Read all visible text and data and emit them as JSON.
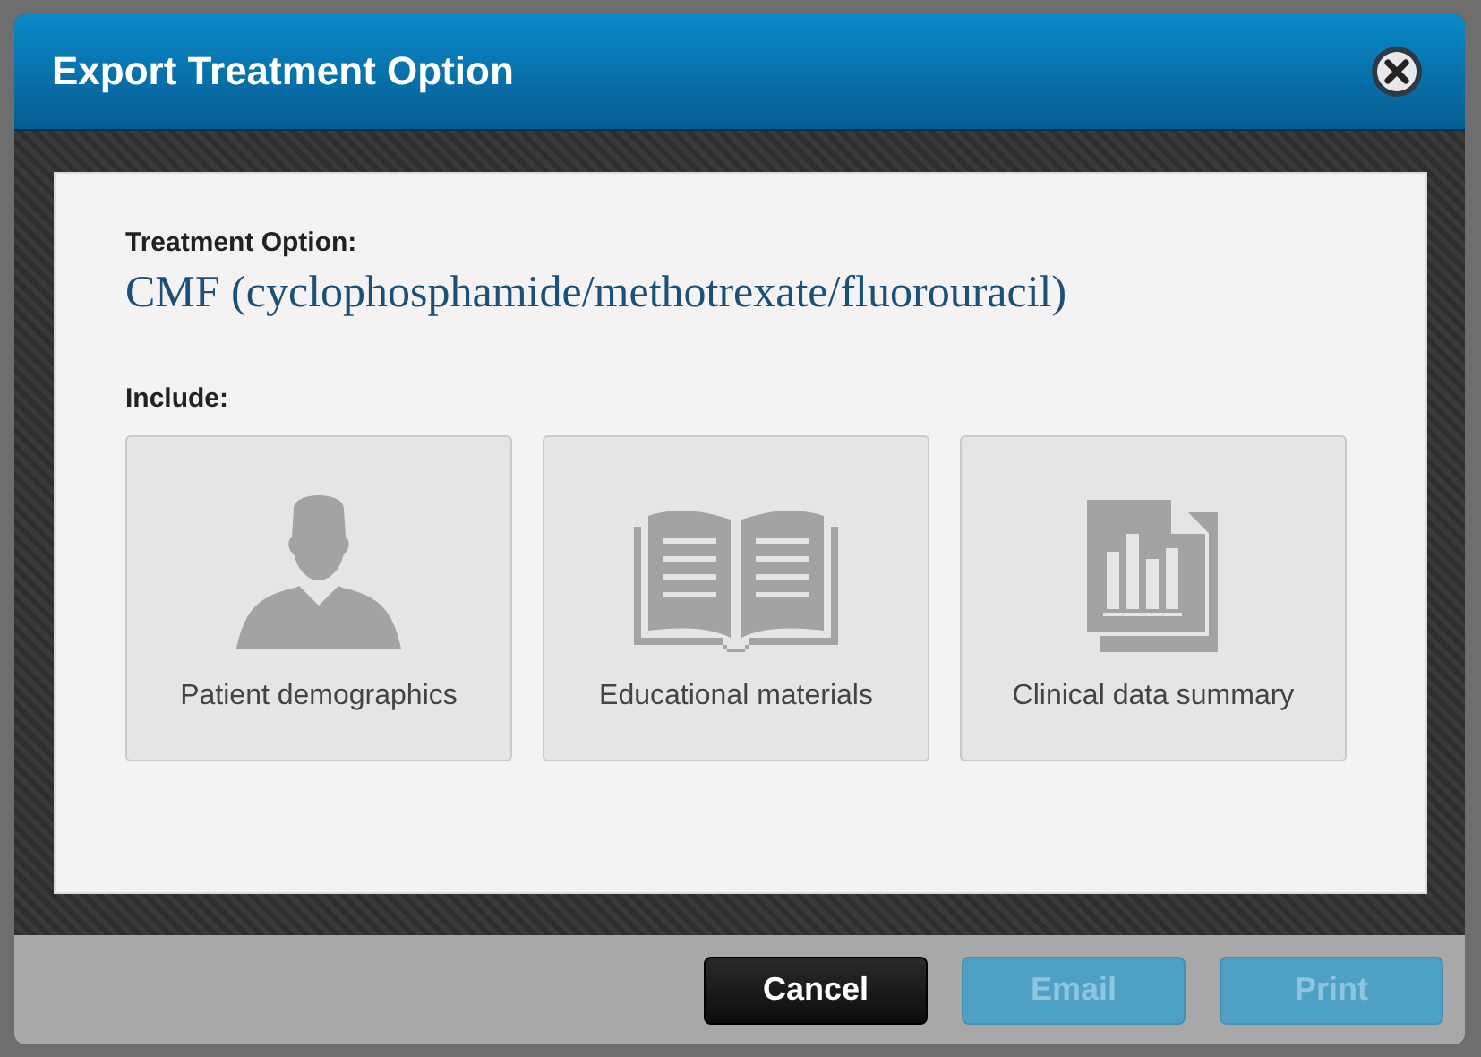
{
  "window": {
    "title": "Export Treatment Option"
  },
  "treatment": {
    "label": "Treatment Option:",
    "value": "CMF (cyclophosphamide/methotrexate/fluorouracil)"
  },
  "include": {
    "label": "Include:",
    "options": [
      {
        "kind": "person",
        "label": "Patient demographics",
        "selected": false
      },
      {
        "kind": "book",
        "label": "Educational materials",
        "selected": false
      },
      {
        "kind": "report",
        "label": "Clinical data summary",
        "selected": false
      }
    ]
  },
  "buttons": [
    {
      "kind": "cancel",
      "label": "Cancel",
      "disabled": false
    },
    {
      "kind": "primary",
      "label": "Email",
      "disabled": true
    },
    {
      "kind": "primary",
      "label": "Print",
      "disabled": true
    }
  ]
}
